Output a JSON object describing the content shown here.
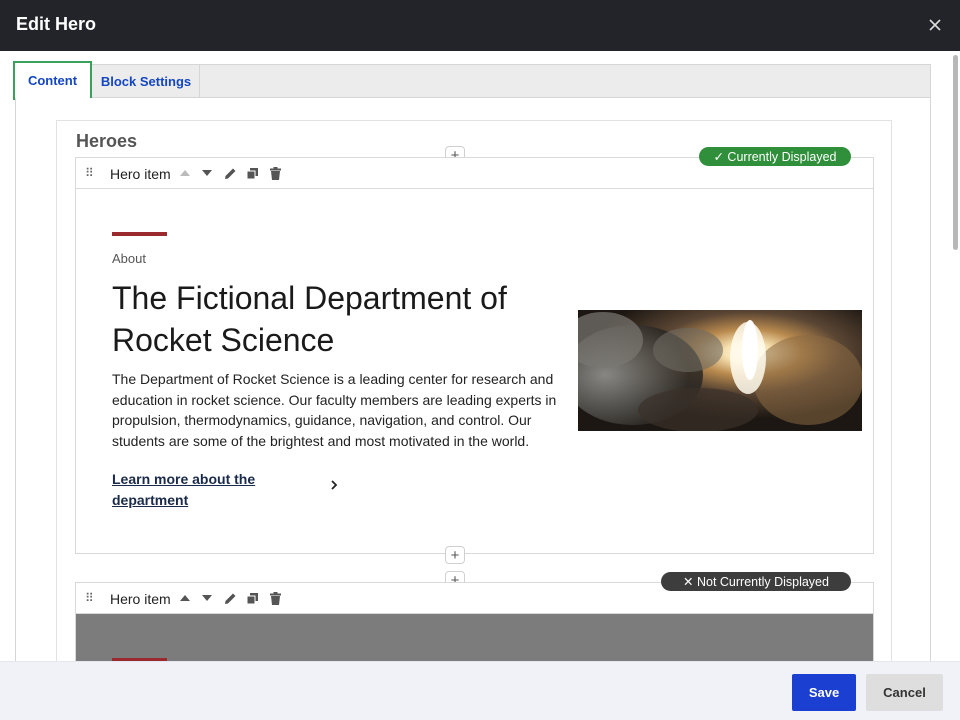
{
  "window": {
    "title": "Edit Hero",
    "close_icon": "close-icon"
  },
  "tabs": [
    {
      "label": "Content",
      "active": true
    },
    {
      "label": "Block Settings",
      "active": false
    }
  ],
  "heroes": {
    "title": "Heroes",
    "items": [
      {
        "label": "Hero item",
        "status": "✓ Currently Displayed",
        "status_color": "#2f8f3a",
        "eyebrow": "About",
        "heading": "The Fictional Department of Rocket Science",
        "description": "The Department of Rocket Science is a leading center for research and education in rocket science. Our faculty members are leading experts in propulsion, thermodynamics, guidance, navigation, and control. Our students are some of the brightest and most motivated in the world.",
        "link_text": "Learn more about the department",
        "image": "rocket-launch-image"
      },
      {
        "label": "Hero item",
        "status": "✕ Not Currently Displayed",
        "status_color": "#3d3d3d"
      }
    ]
  },
  "footer": {
    "save_label": "Save",
    "cancel_label": "Cancel"
  },
  "colors": {
    "titlebar": "#232429",
    "accent": "#9b2a2f",
    "primary": "#1b3fd0",
    "tab_text": "#1446c2",
    "tab_focus": "#3aa05a"
  }
}
